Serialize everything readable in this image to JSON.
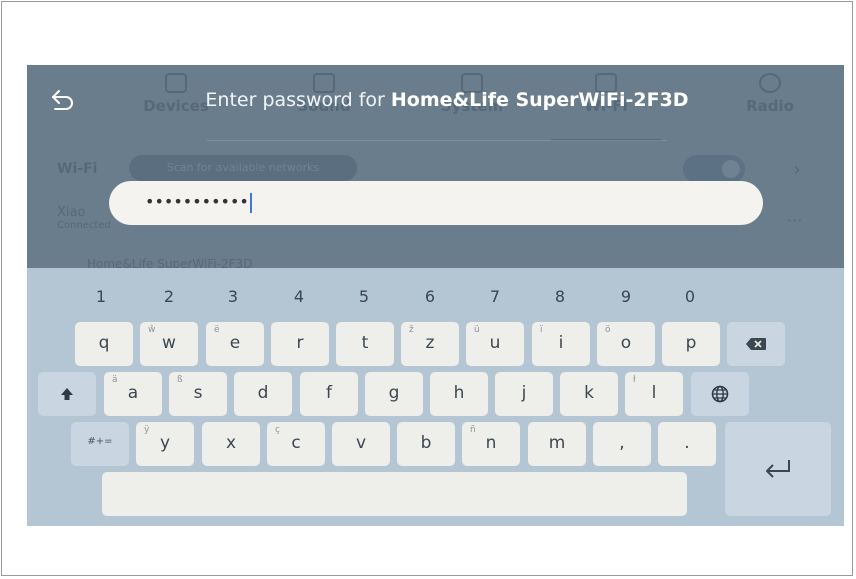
{
  "background": {
    "tabs": [
      "Devices",
      "Sound",
      "System",
      "Wi-Fi",
      "Radio"
    ],
    "wifi_label": "Wi-Fi",
    "scan_label": "Scan for available networks",
    "network_name": "Xiao",
    "network_status": "Connected",
    "network2": "Home&Life SuperWiFi-2F3D"
  },
  "header": {
    "prefix": "Enter password for ",
    "network": "Home&Life SuperWiFi-2F3D"
  },
  "password": {
    "value": "•••••••••••"
  },
  "keyboard": {
    "numbers": [
      "1",
      "2",
      "3",
      "4",
      "5",
      "6",
      "7",
      "8",
      "9",
      "0"
    ],
    "row1": [
      {
        "k": "q",
        "s": ""
      },
      {
        "k": "w",
        "s": "ŵ"
      },
      {
        "k": "e",
        "s": "ë"
      },
      {
        "k": "r",
        "s": ""
      },
      {
        "k": "t",
        "s": ""
      },
      {
        "k": "z",
        "s": "ž"
      },
      {
        "k": "u",
        "s": "ü"
      },
      {
        "k": "i",
        "s": "ï"
      },
      {
        "k": "o",
        "s": "ö"
      },
      {
        "k": "p",
        "s": ""
      }
    ],
    "row2": [
      {
        "k": "a",
        "s": "ä"
      },
      {
        "k": "s",
        "s": "ß"
      },
      {
        "k": "d",
        "s": ""
      },
      {
        "k": "f",
        "s": ""
      },
      {
        "k": "g",
        "s": ""
      },
      {
        "k": "h",
        "s": ""
      },
      {
        "k": "j",
        "s": ""
      },
      {
        "k": "k",
        "s": ""
      },
      {
        "k": "l",
        "s": "ł"
      }
    ],
    "row3": [
      {
        "k": "y",
        "s": "ÿ"
      },
      {
        "k": "x",
        "s": ""
      },
      {
        "k": "c",
        "s": "ç"
      },
      {
        "k": "v",
        "s": ""
      },
      {
        "k": "b",
        "s": ""
      },
      {
        "k": "n",
        "s": "ñ"
      },
      {
        "k": "m",
        "s": ""
      },
      {
        "k": ",",
        "s": ""
      },
      {
        "k": ".",
        "s": ""
      }
    ],
    "symbols_label": "#+="
  }
}
